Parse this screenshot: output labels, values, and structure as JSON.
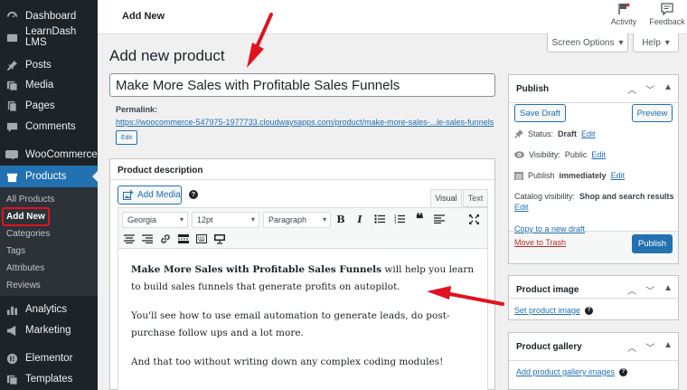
{
  "sidebar": {
    "items": [
      {
        "label": "Dashboard",
        "icon": "dashboard-icon"
      },
      {
        "label": "LearnDash LMS",
        "icon": "learndash-icon"
      },
      {
        "label": "Posts",
        "icon": "pin-icon"
      },
      {
        "label": "Media",
        "icon": "media-icon"
      },
      {
        "label": "Pages",
        "icon": "pages-icon"
      },
      {
        "label": "Comments",
        "icon": "comments-icon"
      },
      {
        "label": "WooCommerce",
        "icon": "woocommerce-icon"
      },
      {
        "label": "Products",
        "icon": "products-icon"
      },
      {
        "label": "Analytics",
        "icon": "analytics-icon"
      },
      {
        "label": "Marketing",
        "icon": "megaphone-icon"
      },
      {
        "label": "Elementor",
        "icon": "elementor-icon"
      },
      {
        "label": "Templates",
        "icon": "templates-icon"
      }
    ],
    "submenu": [
      "All Products",
      "Add New",
      "Categories",
      "Tags",
      "Attributes",
      "Reviews"
    ]
  },
  "topbar": {
    "title": "Add New",
    "activity": "Activity",
    "feedback": "Feedback"
  },
  "screen_options": "Screen Options",
  "help": "Help",
  "page_heading": "Add new product",
  "product_title": "Make More Sales with Profitable Sales Funnels",
  "permalink": {
    "label": "Permalink:",
    "url_prefix": "https://woocommerce-547975-1977733.cloudwaysapps.com/product/",
    "slug": "make-more-sales-...le-sales-funnels",
    "edit": "Edit"
  },
  "editor": {
    "title": "Product description",
    "add_media": "Add Media",
    "tab_visual": "Visual",
    "tab_text": "Text",
    "font_family": "Georgia",
    "font_size": "12pt",
    "format": "Paragraph",
    "para1_bold": "Make More Sales with Profitable Sales Funnels",
    "para1_rest": " will help you learn to build sales funnels that generate profits on autopilot.",
    "para2": "You'll see how to use email automation to generate leads, do post-purchase follow ups and a lot more.",
    "para3": "And that too without writing down any complex coding modules!"
  },
  "publish": {
    "title": "Publish",
    "save_draft": "Save Draft",
    "preview": "Preview",
    "status_label": "Status:",
    "status_value": "Draft",
    "visibility_label": "Visibility:",
    "visibility_value": "Public",
    "publish_label": "Publish",
    "publish_value": "immediately",
    "catalog_label": "Catalog visibility:",
    "catalog_value": "Shop and search results",
    "edit": "Edit",
    "copy_draft": "Copy to a new draft",
    "trash": "Move to Trash",
    "publish_button": "Publish"
  },
  "product_image": {
    "title": "Product image",
    "link": "Set product image"
  },
  "product_gallery": {
    "title": "Product gallery",
    "link": "Add product gallery images"
  },
  "colors": {
    "accent": "#2271b1",
    "sidebar": "#1d2327",
    "annotation": "#e0121f"
  }
}
